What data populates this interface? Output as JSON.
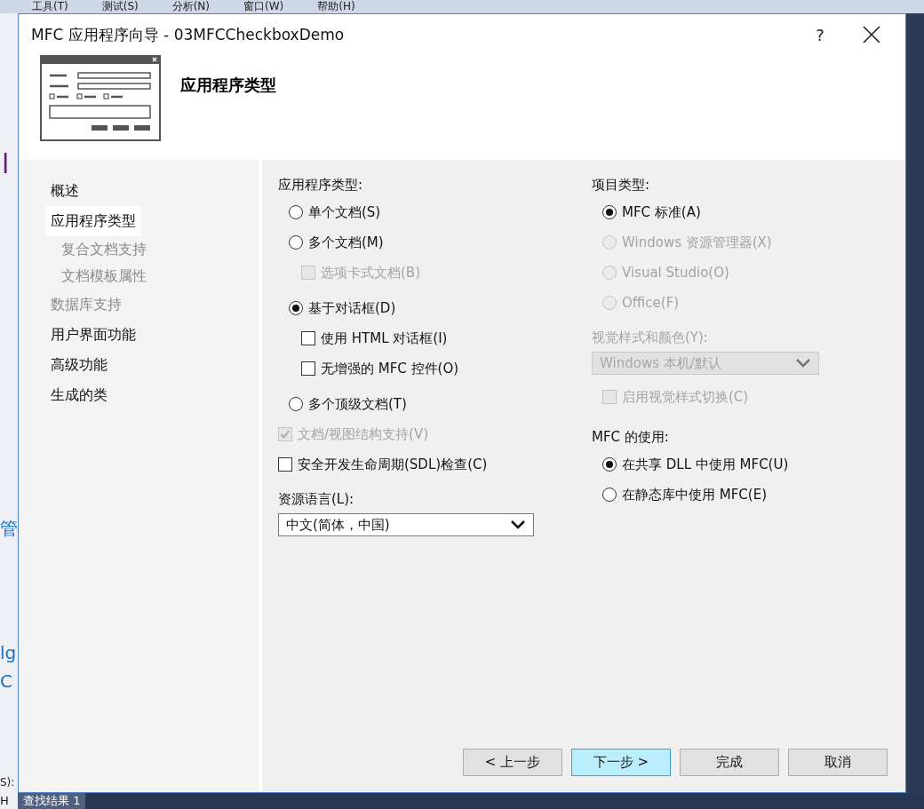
{
  "ide": {
    "menu": [
      {
        "label": "工具(T)"
      },
      {
        "label": "测试(S)"
      },
      {
        "label": "分析(N)"
      },
      {
        "label": "窗口(W)"
      },
      {
        "label": "帮助(H)"
      }
    ],
    "left_fragments": [
      {
        "label": "l",
        "kind": "title"
      },
      {
        "label": "管",
        "kind": "link"
      },
      {
        "label": "lg",
        "kind": "link"
      },
      {
        "label": "C",
        "kind": "link"
      },
      {
        "label": "S):",
        "kind": "plain"
      }
    ],
    "bottom_fragment": "H",
    "bottom_tab": "查找结果 1"
  },
  "dialog": {
    "title": "MFC 应用程序向导 - 03MFCCheckboxDemo",
    "help": "?",
    "heading": "应用程序类型",
    "nav": [
      {
        "label": "概述",
        "selected": false,
        "disabled": false
      },
      {
        "label": "应用程序类型",
        "selected": true,
        "disabled": false,
        "children": [
          {
            "label": "复合文档支持",
            "selected": false,
            "disabled": true
          },
          {
            "label": "文档模板属性",
            "selected": false,
            "disabled": true
          }
        ]
      },
      {
        "label": "数据库支持",
        "selected": false,
        "disabled": true
      },
      {
        "label": "用户界面功能",
        "selected": false,
        "disabled": false
      },
      {
        "label": "高级功能",
        "selected": false,
        "disabled": false
      },
      {
        "label": "生成的类",
        "selected": false,
        "disabled": false
      }
    ],
    "left_column": [
      {
        "kind": "heading",
        "label": "应用程序类型:",
        "disabled": false
      },
      {
        "kind": "radio",
        "label": "单个文档(S)",
        "selected": false,
        "disabled": false
      },
      {
        "kind": "radio",
        "label": "多个文档(M)",
        "selected": false,
        "disabled": false,
        "children": [
          {
            "kind": "checkbox",
            "label": "选项卡式文档(B)",
            "checked": false,
            "disabled": true
          }
        ]
      },
      {
        "kind": "radio",
        "label": "基于对话框(D)",
        "selected": true,
        "disabled": false,
        "children": [
          {
            "kind": "checkbox",
            "label": "使用 HTML 对话框(I)",
            "checked": false,
            "disabled": false
          },
          {
            "kind": "checkbox",
            "label": "无增强的 MFC 控件(O)",
            "checked": false,
            "disabled": false
          }
        ]
      },
      {
        "kind": "radio",
        "label": "多个顶级文档(T)",
        "selected": false,
        "disabled": false
      },
      {
        "kind": "checkbox",
        "label": "文档/视图结构支持(V)",
        "checked": true,
        "disabled": true
      },
      {
        "kind": "checkbox",
        "label": "安全开发生命周期(SDL)检查(C)",
        "checked": false,
        "disabled": false
      },
      {
        "kind": "heading",
        "label": "资源语言(L):",
        "disabled": false
      },
      {
        "kind": "dropdown",
        "value": "中文(简体，中国)",
        "disabled": false
      }
    ],
    "right_column": [
      {
        "kind": "heading",
        "label": "项目类型:",
        "disabled": false
      },
      {
        "kind": "radio",
        "label": "MFC 标准(A)",
        "selected": true,
        "disabled": false
      },
      {
        "kind": "radio",
        "label": "Windows 资源管理器(X)",
        "selected": false,
        "disabled": true
      },
      {
        "kind": "radio",
        "label": "Visual Studio(O)",
        "selected": false,
        "disabled": true
      },
      {
        "kind": "radio",
        "label": "Office(F)",
        "selected": false,
        "disabled": true
      },
      {
        "kind": "heading",
        "label": "视觉样式和颜色(Y):",
        "disabled": true
      },
      {
        "kind": "dropdown",
        "value": "Windows 本机/默认",
        "disabled": true,
        "children": [
          {
            "kind": "checkbox",
            "label": "启用视觉样式切换(C)",
            "checked": false,
            "disabled": true
          }
        ]
      },
      {
        "kind": "heading",
        "label": "MFC 的使用:",
        "disabled": false
      },
      {
        "kind": "radio",
        "label": "在共享 DLL 中使用 MFC(U)",
        "selected": true,
        "disabled": false
      },
      {
        "kind": "radio",
        "label": "在静态库中使用 MFC(E)",
        "selected": false,
        "disabled": false
      }
    ],
    "buttons": [
      {
        "label": "< 上一步",
        "hovered": false
      },
      {
        "label": "下一步 >",
        "hovered": true
      },
      {
        "label": "完成",
        "hovered": false
      },
      {
        "label": "取消",
        "hovered": false
      }
    ]
  }
}
